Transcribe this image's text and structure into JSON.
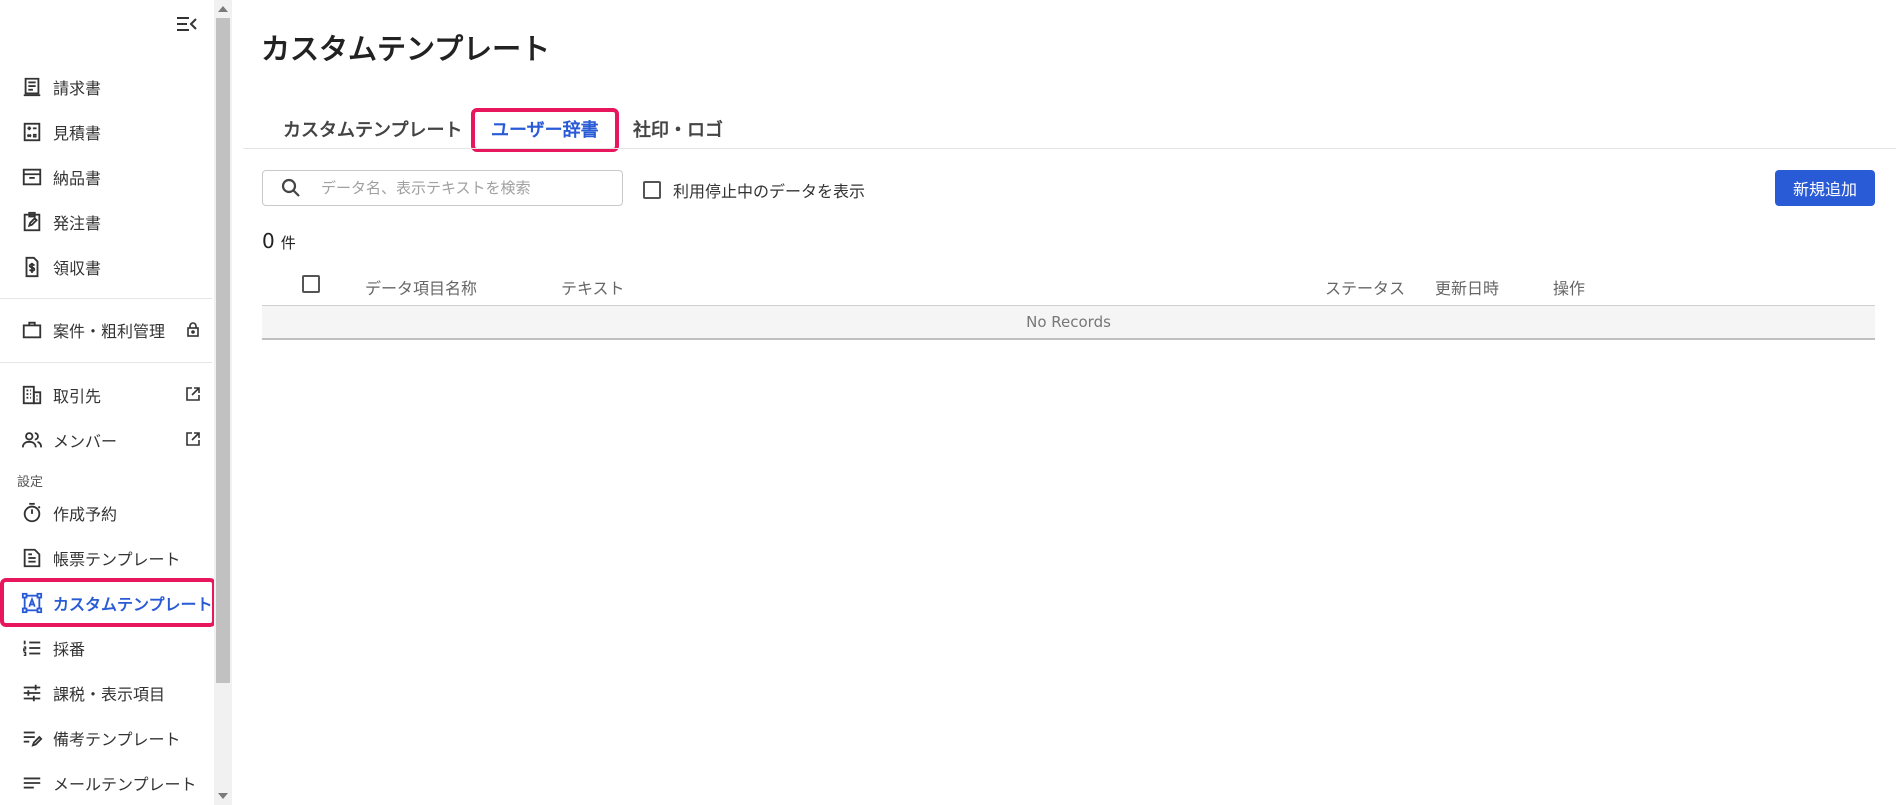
{
  "sidebar": {
    "items": [
      {
        "id": "invoice",
        "label": "請求書",
        "icon": "receipt-icon"
      },
      {
        "id": "estimate",
        "label": "見積書",
        "icon": "calculator-icon"
      },
      {
        "id": "delivery",
        "label": "納品書",
        "icon": "archive-box-icon"
      },
      {
        "id": "purchase-order",
        "label": "発注書",
        "icon": "clipboard-edit-icon"
      },
      {
        "id": "receipt",
        "label": "領収書",
        "icon": "dollar-document-icon"
      },
      {
        "id": "project-management",
        "label": "案件・粗利管理",
        "icon": "briefcase-icon",
        "trail": "lock-icon"
      },
      {
        "id": "clients",
        "label": "取引先",
        "icon": "building-icon",
        "trail": "external-link-icon"
      },
      {
        "id": "members",
        "label": "メンバー",
        "icon": "people-icon",
        "trail": "external-link-icon"
      }
    ],
    "section_label": "設定",
    "settings_items": [
      {
        "id": "scheduled-creation",
        "label": "作成予約",
        "icon": "timer-icon"
      },
      {
        "id": "form-template",
        "label": "帳票テンプレート",
        "icon": "document-lines-icon"
      },
      {
        "id": "custom-template",
        "label": "カスタムテンプレート",
        "icon": "text-box-icon",
        "active": true
      },
      {
        "id": "numbering",
        "label": "採番",
        "icon": "numbered-list-icon"
      },
      {
        "id": "tax-display",
        "label": "課税・表示項目",
        "icon": "sliders-icon"
      },
      {
        "id": "notes-template",
        "label": "備考テンプレート",
        "icon": "edit-note-icon"
      },
      {
        "id": "mail-template",
        "label": "メールテンプレート",
        "icon": "lines-icon"
      }
    ],
    "active_color": "#2a5bd7",
    "highlight_color": "#e8175d"
  },
  "main": {
    "title": "カスタムテンプレート",
    "tabs": [
      {
        "label": "カスタムテンプレート",
        "active": false
      },
      {
        "label": "ユーザー辞書",
        "active": true
      },
      {
        "label": "社印・ロゴ",
        "active": false
      }
    ],
    "search": {
      "placeholder": "データ名、表示テキストを検索",
      "value": ""
    },
    "show_inactive_label": "利用停止中のデータを表示",
    "add_button_label": "新規追加",
    "count": {
      "value": "0",
      "unit": "件"
    },
    "table": {
      "columns": [
        "データ項目名称",
        "テキスト",
        "ステータス",
        "更新日時",
        "操作"
      ],
      "empty_text": "No Records"
    }
  }
}
